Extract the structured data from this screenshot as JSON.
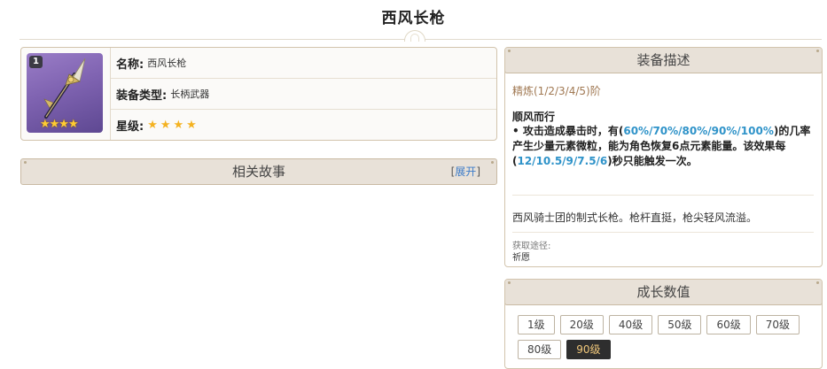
{
  "page": {
    "title": "西风长枪"
  },
  "info": {
    "refine_badge": "1",
    "name_label": "名称:",
    "name_value": "西风长枪",
    "type_label": "装备类型:",
    "type_value": "长柄武器",
    "rarity_label": "星级:",
    "rarity": 4,
    "rarity_stars": "★★★★",
    "thumb_stars": "★★★★"
  },
  "story": {
    "title": "相关故事",
    "expand_open": "[",
    "expand_label": "展开",
    "expand_close": "]"
  },
  "description": {
    "title": "装备描述",
    "refine_levels": "精炼(1/2/3/4/5)阶",
    "passive_name": "顺风而行",
    "passive_parts": {
      "p1": "• 攻击造成暴击时，有(",
      "v1": "60%/70%/80%/90%/100%",
      "p2": ")的几率产生少量元素微粒，能为角色恢复6点元素能量。该效果每(",
      "v2": "12/10.5/9/7.5/6",
      "p3": ")秒只能触发一次。"
    },
    "flavor": "西风骑士团的制式长枪。枪杆直挺，枪尖轻风流溢。",
    "source_label": "获取途径:",
    "source_value": "祈愿"
  },
  "growth": {
    "title": "成长数值",
    "levels": [
      "1级",
      "20级",
      "40级",
      "50级",
      "60级",
      "70级",
      "80级",
      "90级"
    ],
    "selected": "90级"
  },
  "colors": {
    "accent_highlight": "#2f93c9",
    "refine_text": "#a07852",
    "thumb_bg": "#8a6dbd",
    "star": "#f4b221",
    "section_bar": "#e8e1d8"
  }
}
